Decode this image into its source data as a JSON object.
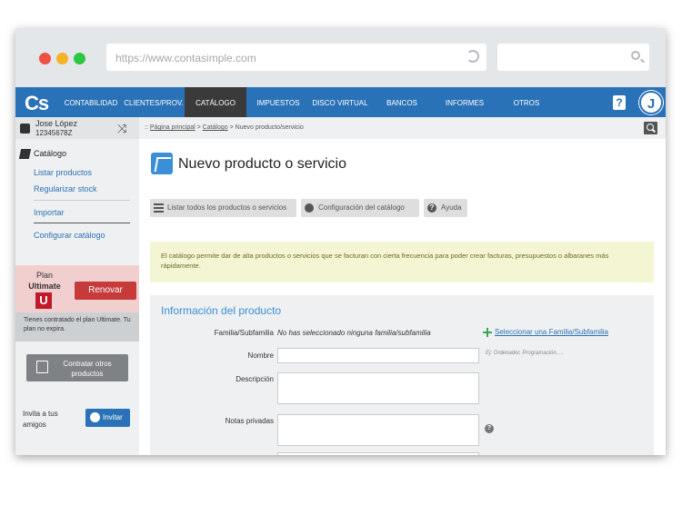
{
  "browser": {
    "url": "https://www.contasimple.com"
  },
  "nav": {
    "logo": "Cs",
    "items": [
      {
        "label": "CONTABILIDAD"
      },
      {
        "label": "CLIENTES/PROV."
      },
      {
        "label": "CATÁLOGO",
        "active": true
      },
      {
        "label": "IMPUESTOS"
      },
      {
        "label": "DISCO VIRTUAL"
      },
      {
        "label": "BANCOS"
      },
      {
        "label": "INFORMES"
      },
      {
        "label": "OTROS"
      }
    ],
    "help": "?",
    "avatar": "J",
    "accent": "#2a72b7"
  },
  "sidebar": {
    "user_name": "Jose López",
    "user_id": "12345678Z",
    "section_title": "Catálogo",
    "links": [
      "Listar productos",
      "Regularizar stock",
      "Importar",
      "Configurar catálogo"
    ],
    "plan_label": "Plan",
    "plan_name": "Ultimate",
    "plan_badge": "U",
    "renew_label": "Renovar",
    "plan_info": "Tienes contratado el plan Ultimate. Tu plan no expira.",
    "contract_label": "Contratar otros productos",
    "invite_text": "Invita a tus amigos",
    "invite_button": "Invitar"
  },
  "breadcrumb": {
    "prefix": "::",
    "home": "Página principal",
    "section": "Catálogo",
    "current": "Nuevo producto/servicio"
  },
  "page": {
    "title": "Nuevo producto o servicio",
    "toolbar": [
      {
        "label": "Listar todos los productos o servicios",
        "icon": "list-icon"
      },
      {
        "label": "Configuración del catálogo",
        "icon": "gear-icon"
      },
      {
        "label": "Ayuda",
        "icon": "help-icon"
      }
    ],
    "info_text": "El catálogo permite dar de alta productos o servicios que se facturan con cierta frecuencia para poder crear facturas, presupuestos o albaranes más rápidamente.",
    "form": {
      "title": "Información del producto",
      "family_label": "Familia/Subfamilia",
      "family_value": "No has seleccionado ninguna familia/subfamilia",
      "family_link": "Seleccionar una Familia/Subfamilia",
      "name_label": "Nombre",
      "name_value": "",
      "name_hint": "Ej: Ordenador, Programación, ...",
      "description_label": "Descripción",
      "description_value": "",
      "private_notes_label": "Notas privadas",
      "private_notes_value": "",
      "help_mark": "?"
    }
  }
}
